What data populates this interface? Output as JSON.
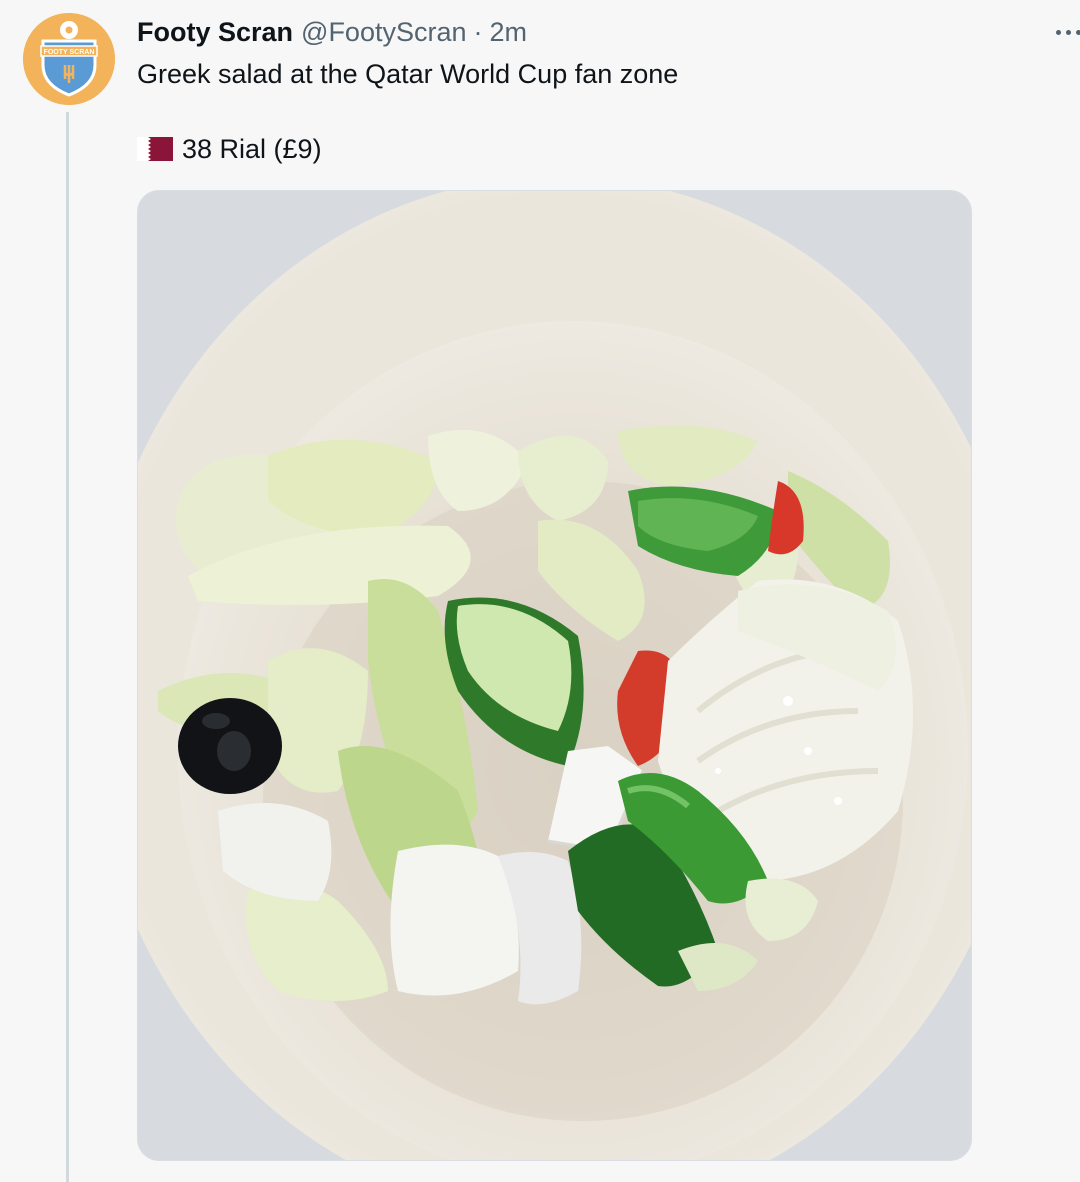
{
  "tweet": {
    "display_name": "Footy Scran",
    "handle": "@FootyScran",
    "separator": "·",
    "time": "2m",
    "text": "Greek salad at the Qatar World Cup fan zone",
    "price": "38 Rial (£9)",
    "flag_icon": "qatar-flag-icon",
    "avatar_logo_text": "FOOTY SCRAN",
    "media_description_icon": "salad-photo"
  },
  "colors": {
    "avatar_bg": "#f2b35a",
    "shield_blue": "#5b9bd5",
    "qatar_maroon": "#8a1538",
    "text_primary": "#0f1419",
    "text_secondary": "#536471"
  }
}
